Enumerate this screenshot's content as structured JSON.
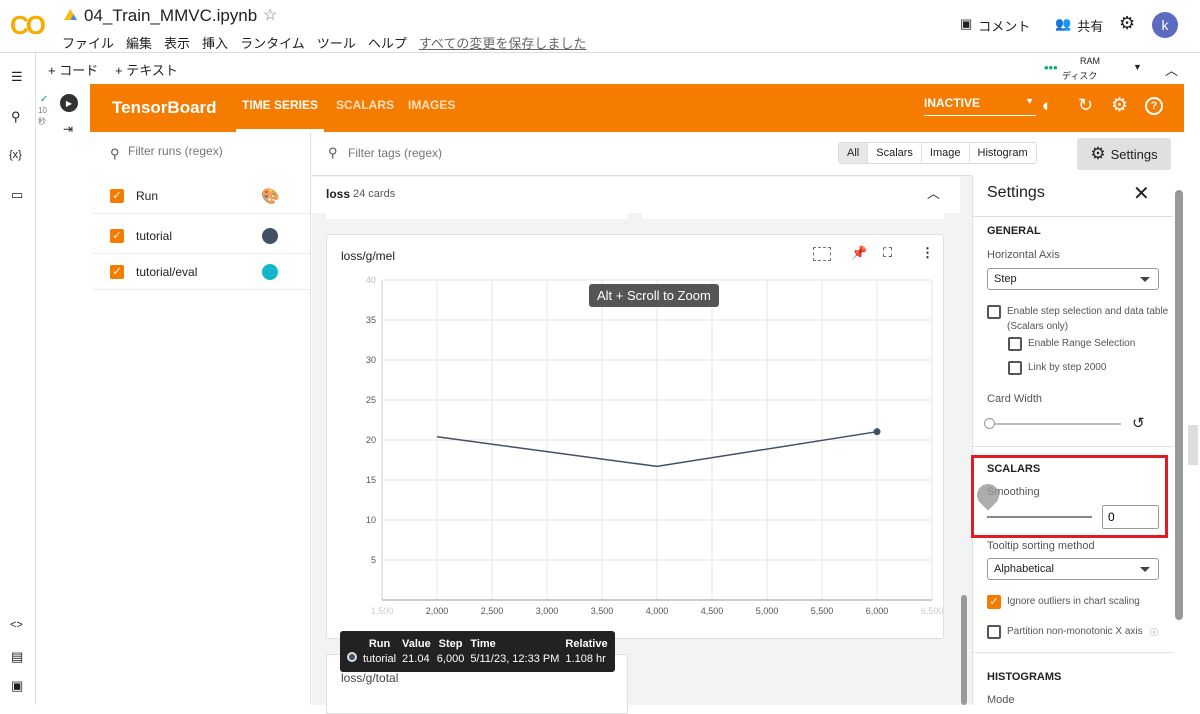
{
  "colab": {
    "filename": "04_Train_MMVC.ipynb",
    "menu": [
      "ファイル",
      "編集",
      "表示",
      "挿入",
      "ランタイム",
      "ツール",
      "ヘルプ"
    ],
    "save_status": "すべての変更を保存しました",
    "comment": "コメント",
    "share": "共有",
    "avatar": "k",
    "add_code": "+ コード",
    "add_text": "+ テキスト",
    "ram": "RAM",
    "disk": "ディスク",
    "cell_time": "10",
    "cell_time_unit": "秒"
  },
  "tensorboard": {
    "title": "TensorBoard",
    "tabs": [
      "TIME SERIES",
      "SCALARS",
      "IMAGES"
    ],
    "status": "INACTIVE",
    "filter_runs_placeholder": "Filter runs (regex)",
    "filter_tags_placeholder": "Filter tags (regex)",
    "runs": [
      {
        "label": "Run",
        "color": "palette"
      },
      {
        "label": "tutorial",
        "color": "#425066"
      },
      {
        "label": "tutorial/eval",
        "color": "#12b5cb"
      }
    ],
    "type_chips": [
      "All",
      "Scalars",
      "Image",
      "Histogram"
    ],
    "settings_button": "Settings",
    "group": {
      "name": "loss",
      "count": "24 cards"
    },
    "card_title": "loss/g/mel",
    "zoom_hint": "Alt + Scroll to Zoom",
    "next_card_title": "loss/g/total",
    "tooltip": {
      "headers": [
        "Run",
        "Value",
        "Step",
        "Time",
        "Relative"
      ],
      "row": [
        "tutorial",
        "21.04",
        "6,000",
        "5/11/23, 12:33 PM",
        "1.108 hr"
      ]
    }
  },
  "settings": {
    "title": "Settings",
    "general": "GENERAL",
    "horizontal_axis_label": "Horizontal Axis",
    "horizontal_axis": "Step",
    "step_selection": "Enable step selection and data table",
    "scalars_only": "(Scalars only)",
    "range_selection": "Enable Range Selection",
    "link_step": "Link by step 2000",
    "card_width": "Card Width",
    "scalars": "SCALARS",
    "smoothing": "Smoothing",
    "smoothing_value": "0",
    "tooltip_sort_label": "Tooltip sorting method",
    "tooltip_sort": "Alphabetical",
    "ignore_outliers": "Ignore outliers in chart scaling",
    "partition": "Partition non-monotonic X axis",
    "histograms": "HISTOGRAMS",
    "mode": "Mode"
  },
  "chart_data": {
    "type": "line",
    "title": "loss/g/mel",
    "xlim": [
      1500,
      6500
    ],
    "ylim": [
      0,
      40
    ],
    "xticks": [
      1500,
      2000,
      2500,
      3000,
      3500,
      4000,
      4500,
      5000,
      5500,
      6000,
      6500
    ],
    "xtick_labels": [
      "1,500",
      "2,000",
      "2,500",
      "3,000",
      "3,500",
      "4,000",
      "4,500",
      "5,000",
      "5,500",
      "6,000",
      "6,500"
    ],
    "yticks": [
      0,
      5,
      10,
      15,
      20,
      25,
      30,
      35,
      40
    ],
    "grid": true,
    "series": [
      {
        "name": "tutorial",
        "color": "#425066",
        "x": [
          2000,
          4000,
          6000
        ],
        "y": [
          20.4,
          16.7,
          21.04
        ]
      }
    ]
  }
}
